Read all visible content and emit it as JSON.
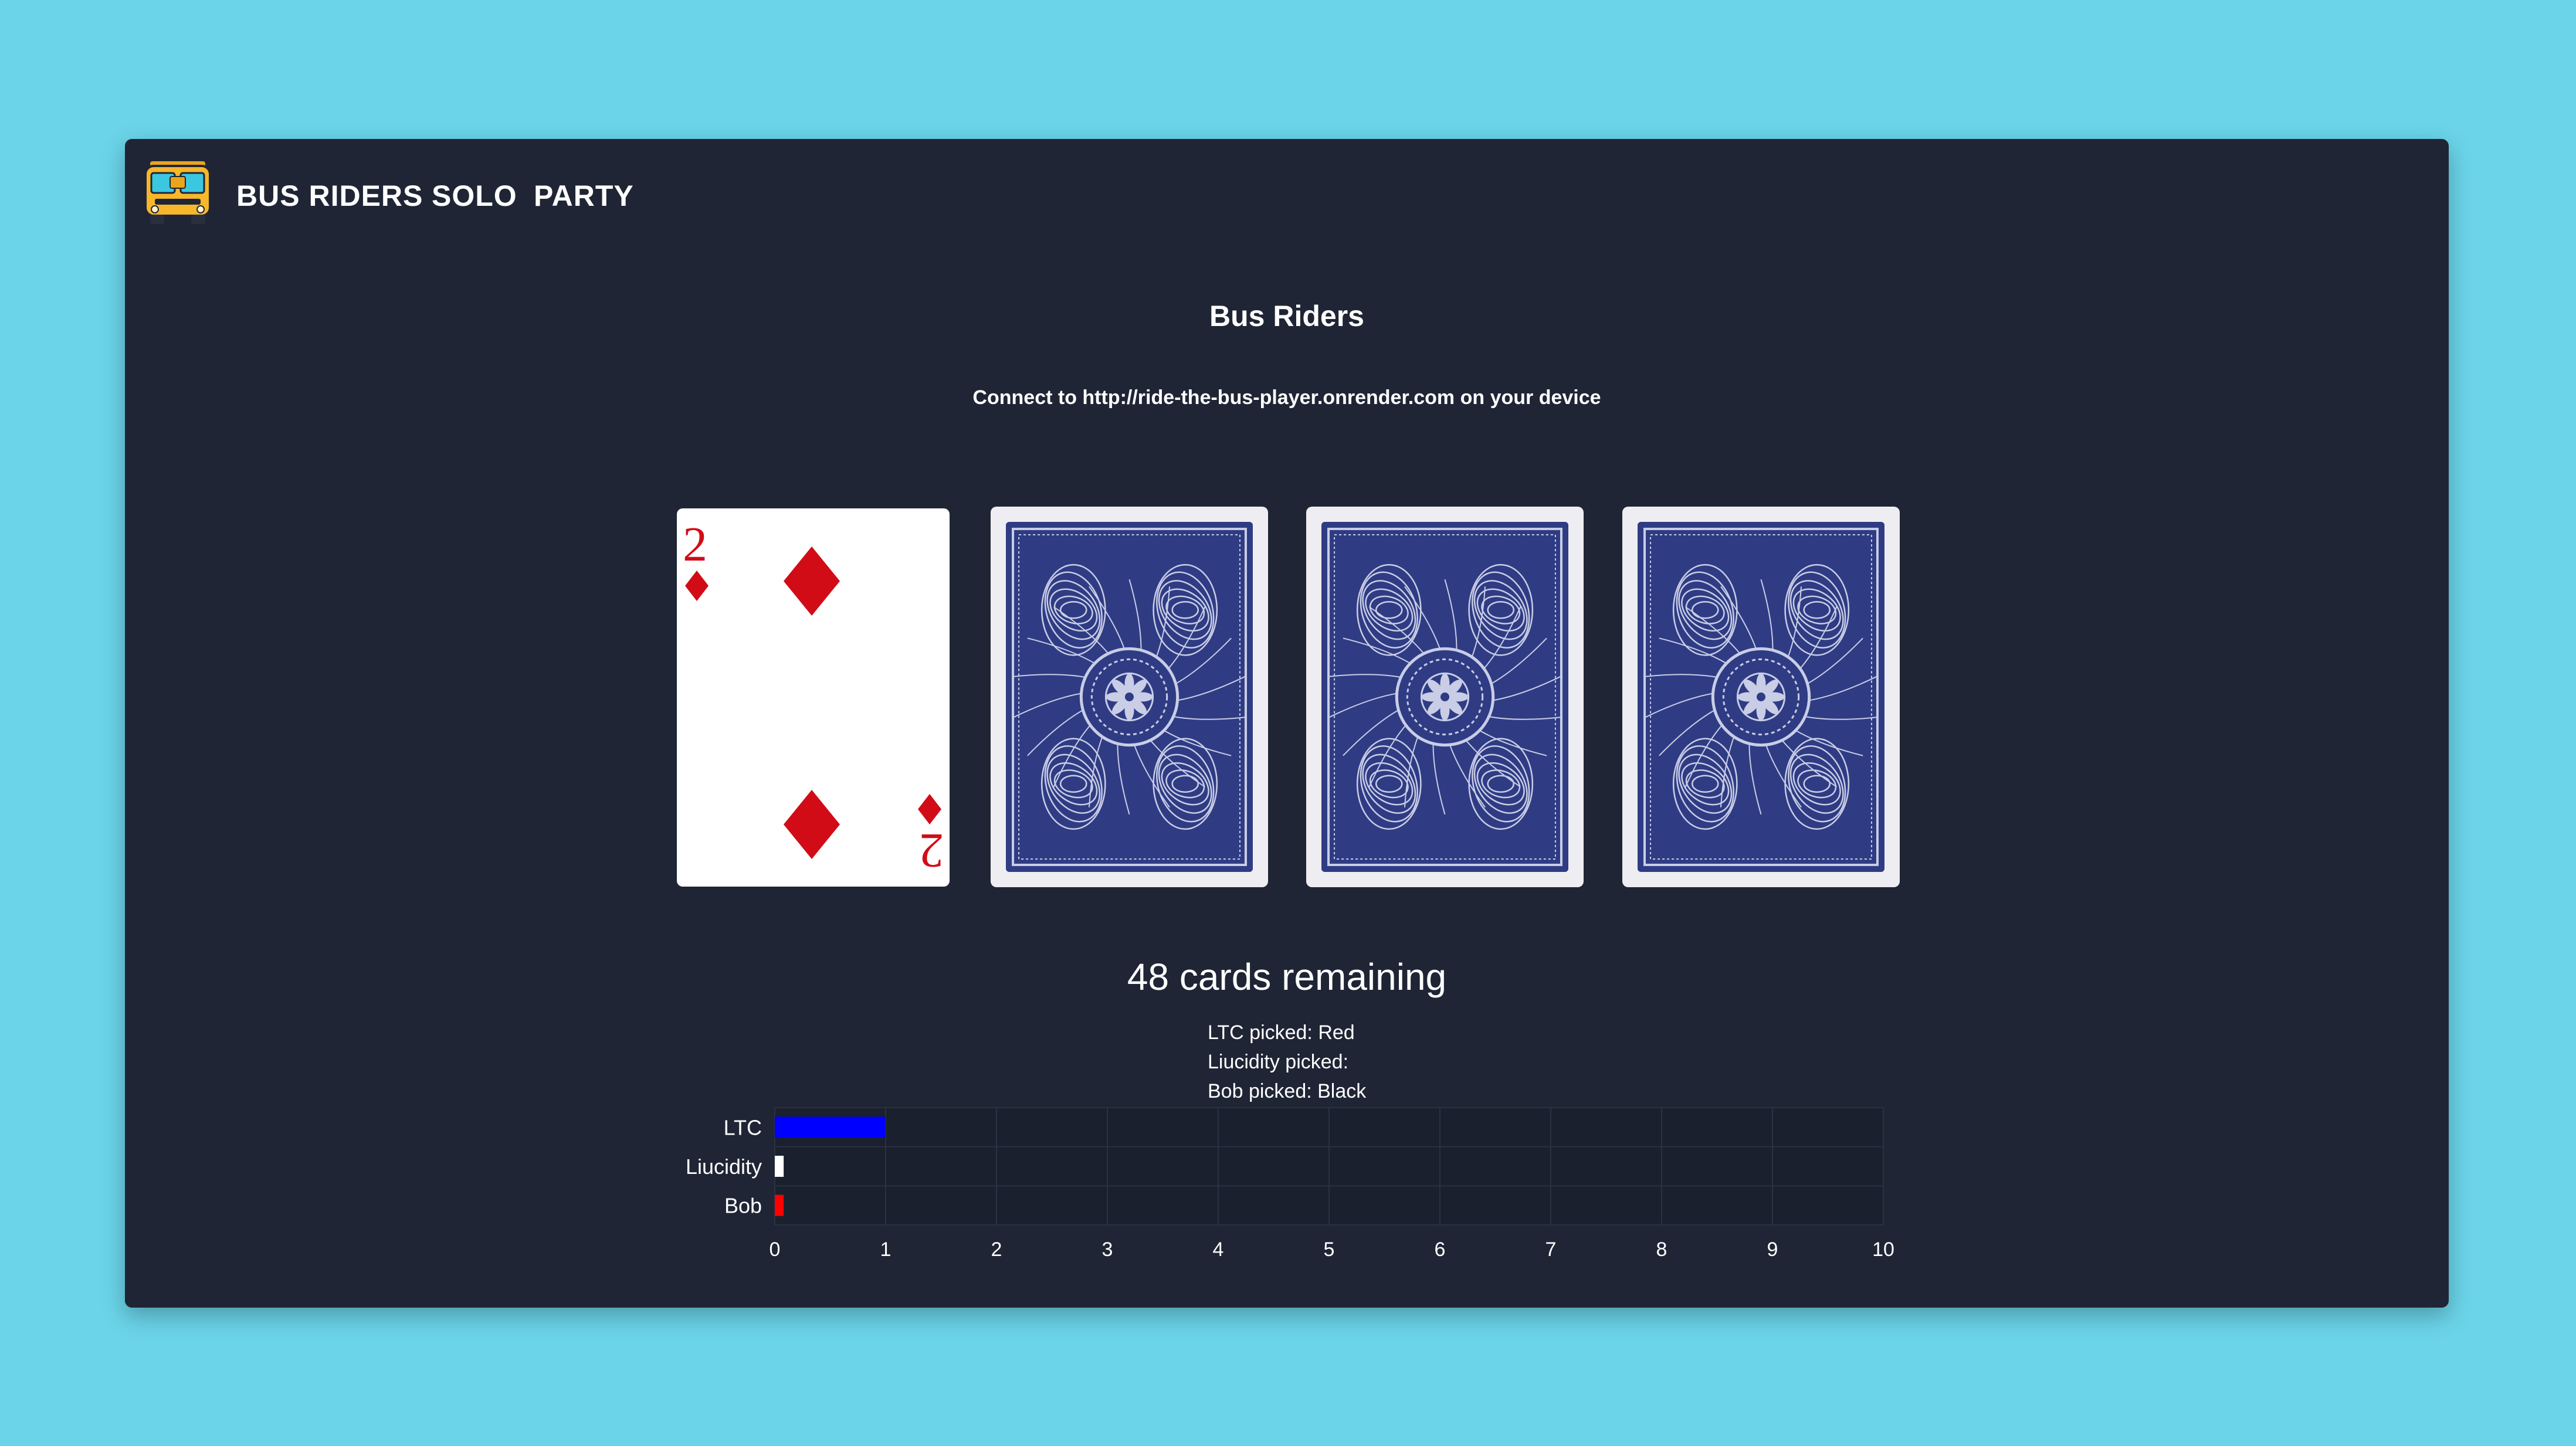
{
  "nav": {
    "brand_label": "BUS RIDERS",
    "solo_label": "SOLO",
    "party_label": "PARTY",
    "logo_icon": "school-bus-icon"
  },
  "main": {
    "title": "Bus Riders",
    "connect_text": "Connect to http://ride-the-bus-player.onrender.com on your device",
    "cards_remaining": "48 cards remaining"
  },
  "cards": [
    {
      "face": "up",
      "rank": "2",
      "suit": "diamonds",
      "suit_symbol": "♦"
    },
    {
      "face": "down"
    },
    {
      "face": "down"
    },
    {
      "face": "down"
    }
  ],
  "picks": [
    "LTC picked: Red",
    "Liucidity picked:",
    "Bob picked: Black"
  ],
  "colors": {
    "background": "#6bd4e9",
    "window": "#1f2535",
    "card_red": "#d20c17",
    "card_back": "#2f3c84"
  },
  "chart_data": {
    "type": "bar",
    "orientation": "horizontal",
    "categories": [
      "LTC",
      "Liucidity",
      "Bob"
    ],
    "values": [
      1,
      0.08,
      0.08
    ],
    "colors": [
      "#0000ff",
      "#ffffff",
      "#ff0000"
    ],
    "xlim": [
      0,
      10
    ],
    "xticks": [
      0,
      1,
      2,
      3,
      4,
      5,
      6,
      7,
      8,
      9,
      10
    ],
    "grid": true,
    "title": "",
    "xlabel": "",
    "ylabel": ""
  }
}
